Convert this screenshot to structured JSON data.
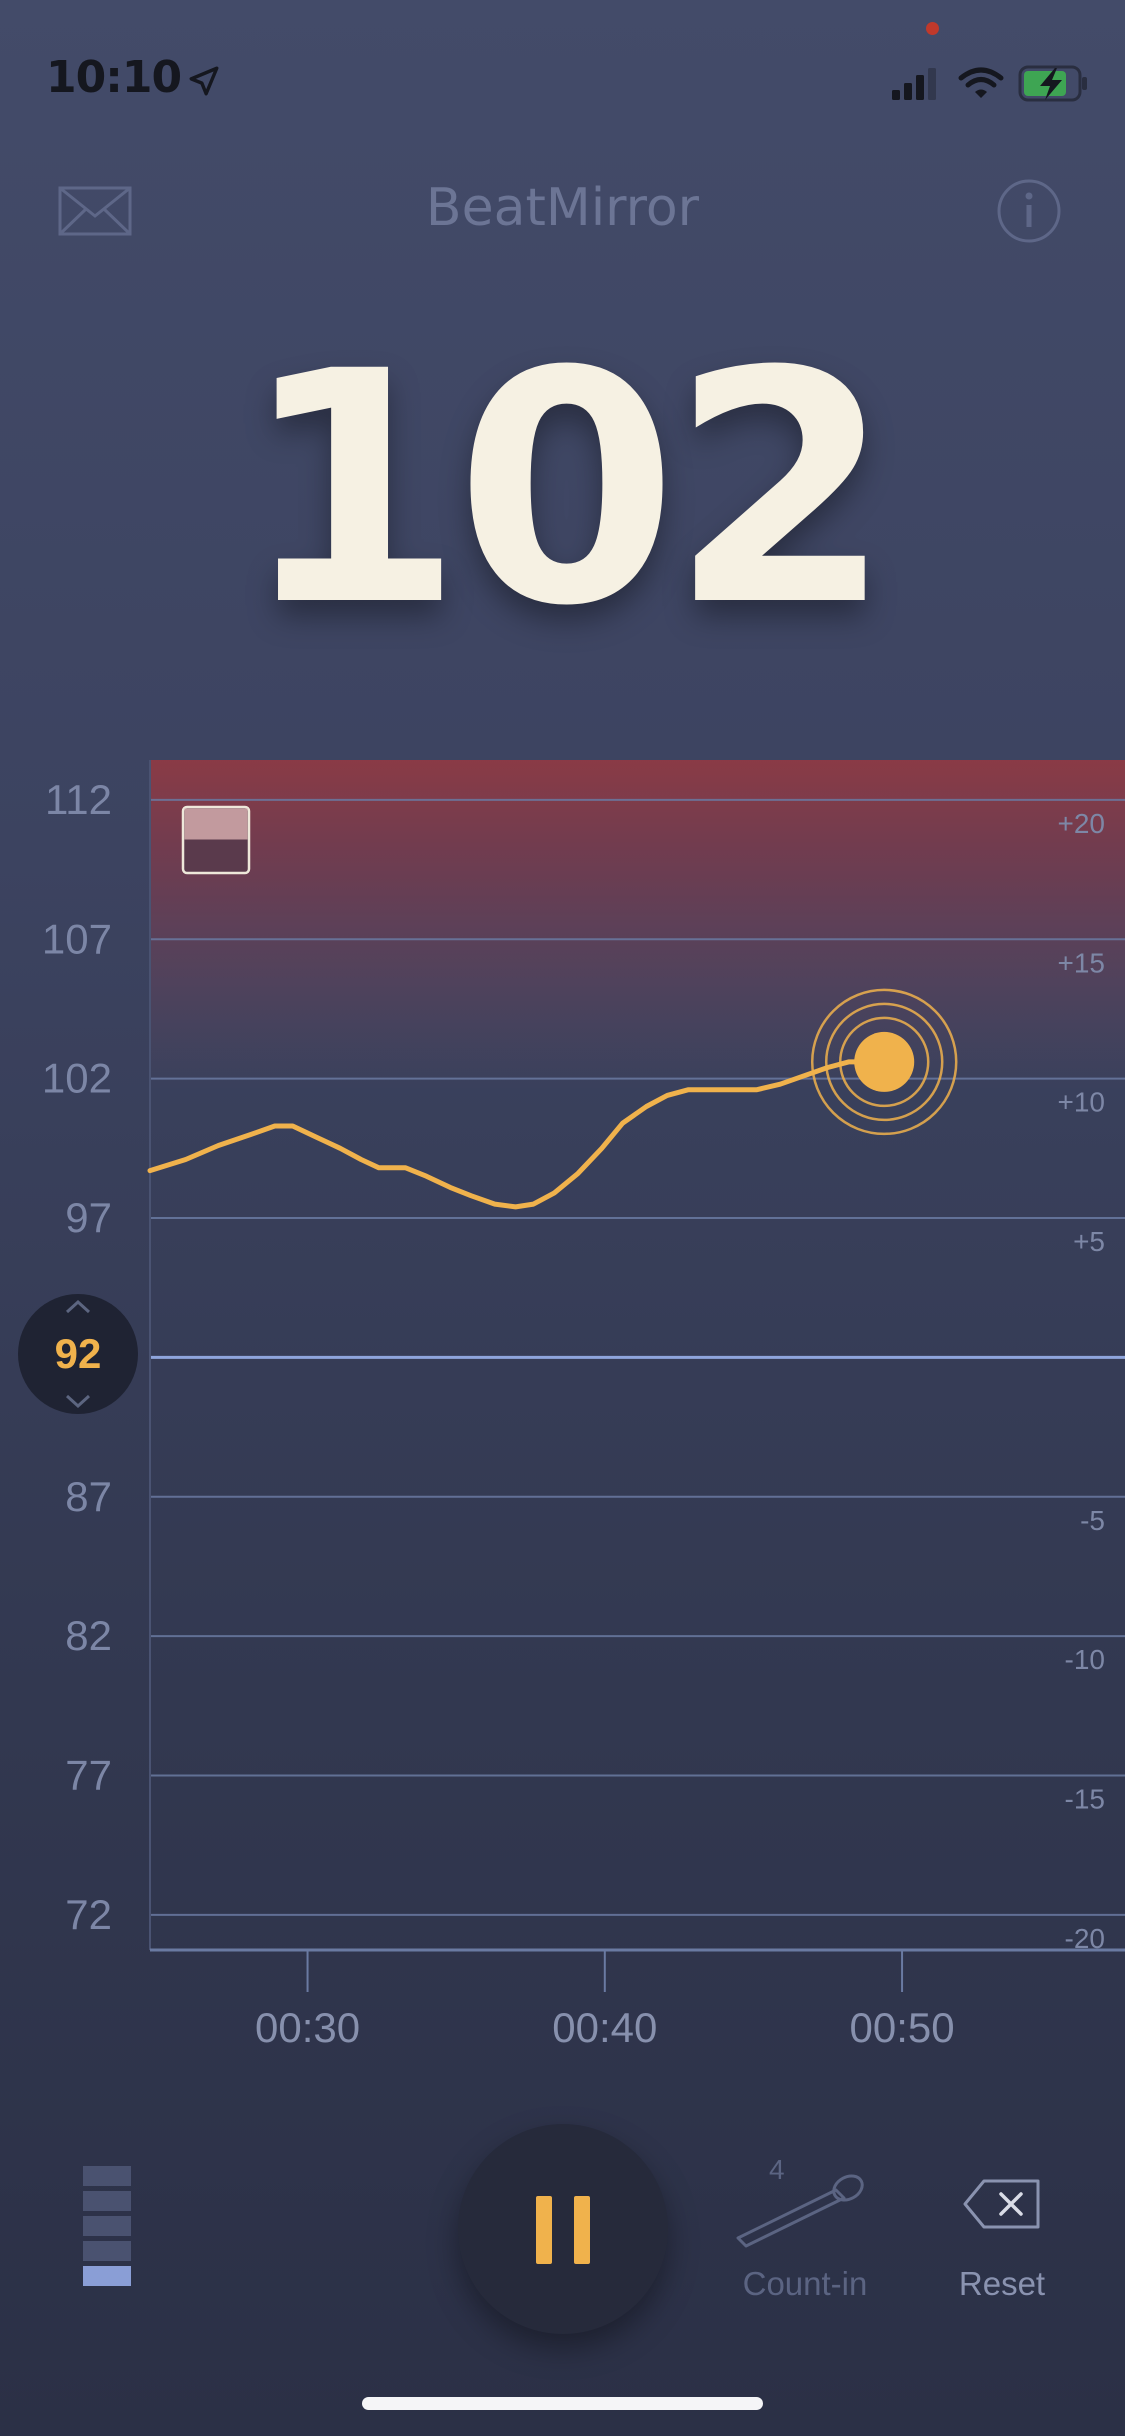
{
  "status_bar": {
    "time": "10:10",
    "icons": [
      "location-arrow-icon",
      "recording-dot-icon",
      "cellular-signal-icon",
      "wifi-icon",
      "battery-charging-icon"
    ]
  },
  "header": {
    "title": "BeatMirror",
    "left_icon": "envelope-icon",
    "right_icon": "info-icon"
  },
  "tempo": {
    "current_bpm": "102",
    "target_bpm": "92"
  },
  "chart_data": {
    "type": "line",
    "y_left_ticks": [
      "112",
      "107",
      "102",
      "97",
      "87",
      "82",
      "77",
      "72"
    ],
    "y_right_ticks": [
      "+20",
      "+15",
      "+10",
      "+5",
      "-5",
      "-10",
      "-15",
      "-20"
    ],
    "x_ticks": [
      "00:30",
      "00:40",
      "00:50"
    ],
    "x_ticks_seconds": [
      30,
      40,
      50
    ],
    "xlim_seconds": [
      24.7,
      57.5
    ],
    "ylim": [
      71.1,
      113.0
    ],
    "reference_line": 92,
    "highlight_band_above": 107,
    "series": [
      {
        "points": [
          [
            24.7,
            98.7
          ],
          [
            25.9,
            99.1
          ],
          [
            27.0,
            99.6
          ],
          [
            28.1,
            100.0
          ],
          [
            28.9,
            100.3
          ],
          [
            29.5,
            100.3
          ],
          [
            30.3,
            99.9
          ],
          [
            31.1,
            99.5
          ],
          [
            31.8,
            99.1
          ],
          [
            32.4,
            98.8
          ],
          [
            33.3,
            98.8
          ],
          [
            34.0,
            98.5
          ],
          [
            34.8,
            98.1
          ],
          [
            35.5,
            97.8
          ],
          [
            36.3,
            97.5
          ],
          [
            37.0,
            97.4
          ],
          [
            37.6,
            97.5
          ],
          [
            38.3,
            97.9
          ],
          [
            39.1,
            98.6
          ],
          [
            39.9,
            99.5
          ],
          [
            40.6,
            100.4
          ],
          [
            41.4,
            101.0
          ],
          [
            42.1,
            101.4
          ],
          [
            42.8,
            101.6
          ],
          [
            43.6,
            101.6
          ],
          [
            44.3,
            101.6
          ],
          [
            45.1,
            101.6
          ],
          [
            45.9,
            101.8
          ],
          [
            46.7,
            102.1
          ],
          [
            47.5,
            102.4
          ],
          [
            48.2,
            102.6
          ],
          [
            48.9,
            102.6
          ]
        ],
        "current_point": [
          49.4,
          102.6
        ],
        "color": "#f0b24c"
      }
    ],
    "colors": {
      "line": "#f0b24c",
      "grid": "#6a7aa2",
      "reference": "#8fa5dc",
      "band_top": "#8e3a44"
    }
  },
  "controls": {
    "countin_label": "Count-in",
    "countin_value": "4",
    "reset_label": "Reset",
    "level_meter_segments": 5,
    "level_meter_lit": 1
  }
}
